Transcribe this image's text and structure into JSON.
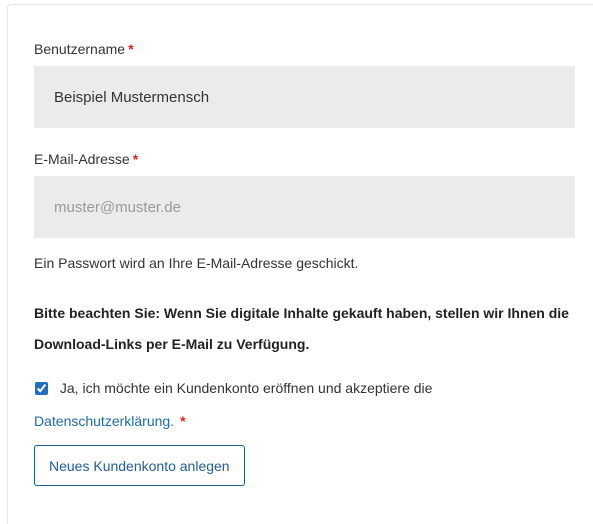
{
  "form": {
    "username": {
      "label": "Benutzername",
      "required_mark": "*",
      "value": "Beispiel Mustermensch"
    },
    "email": {
      "label": "E-Mail-Adresse",
      "required_mark": "*",
      "value": "",
      "placeholder": "muster@muster.de"
    },
    "password_note": "Ein Passwort wird an Ihre E-Mail-Adresse geschickt.",
    "download_note": "Bitte beachten Sie: Wenn Sie digitale Inhalte gekauft haben, stellen wir Ihnen die Download-Links per E-Mail zu Verfügung.",
    "consent": {
      "checked": true,
      "text": "Ja, ich möchte ein Kundenkonto eröffnen und akzeptiere die",
      "link_label": "Datenschutzerklärung.",
      "required_mark": "*"
    },
    "submit_label": "Neues Kundenkonto anlegen"
  },
  "colors": {
    "required": "#e2231a",
    "link": "#1a6cb2",
    "button_border": "#1f5d9b",
    "field_background": "#ebebeb"
  }
}
